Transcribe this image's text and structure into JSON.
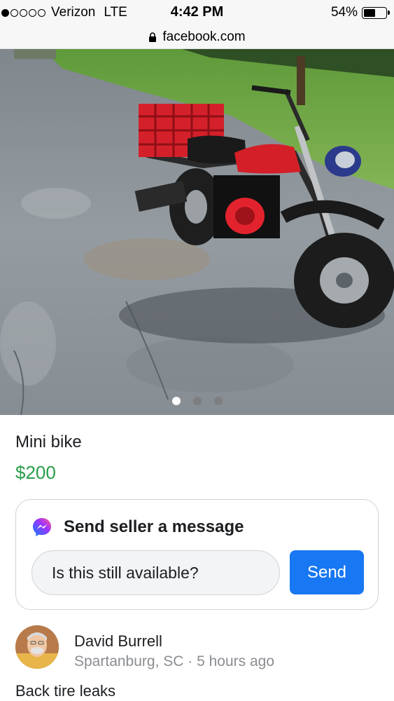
{
  "status_bar": {
    "carrier": "Verizon",
    "network": "LTE",
    "time": "4:42 PM",
    "battery": "54%",
    "battery_level": 0.54,
    "signal_bars_filled": 1,
    "signal_bars_total": 5
  },
  "browser": {
    "url": "facebook.com"
  },
  "photo": {
    "pager_count": 3,
    "pager_active_index": 0
  },
  "listing": {
    "title": "Mini bike",
    "price": "$200",
    "description": "Back tire leaks"
  },
  "message_card": {
    "heading": "Send seller a message",
    "input_value": "Is this still available?",
    "send_label": "Send"
  },
  "seller": {
    "name": "David Burrell",
    "location": "Spartanburg, SC",
    "separator": " · ",
    "posted": "5 hours ago"
  },
  "colors": {
    "price_green": "#2a9d4a",
    "send_blue": "#1877f2",
    "meta_gray": "#8a8d91"
  },
  "icons": {
    "lock": "lock-icon",
    "messenger": "messenger-icon",
    "battery": "battery-icon"
  }
}
